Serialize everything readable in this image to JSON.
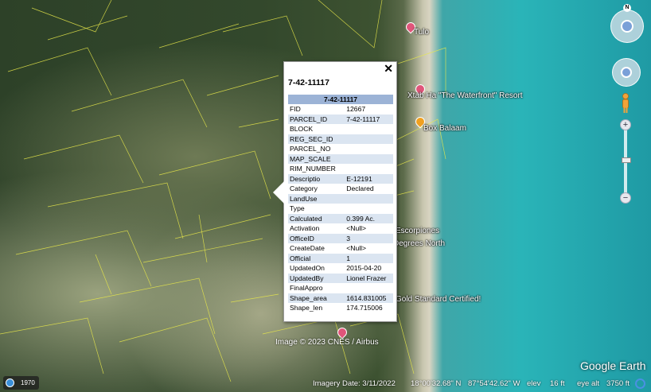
{
  "map": {
    "labels": [
      {
        "id": "tulo",
        "text": "Tulo"
      },
      {
        "id": "xtabha",
        "text": "Xtab Ha \"The Waterfront\" Resort"
      },
      {
        "id": "balaam",
        "text": "Box Balaam"
      },
      {
        "id": "escorpiones",
        "text": "Escorpiones"
      },
      {
        "id": "degrees-north",
        "text": "Degrees North"
      },
      {
        "id": "gold-standard",
        "text": "Gold Standard Certified!"
      }
    ],
    "pin_colors": {
      "pink": "#e0557a",
      "orange": "#f0a020"
    }
  },
  "popup": {
    "title": "7-42-11117",
    "table_header": "7-42-11117",
    "close_label": "✕",
    "rows": [
      {
        "field": "FID",
        "value": "12667"
      },
      {
        "field": "PARCEL_ID",
        "value": "7-42-11117"
      },
      {
        "field": "BLOCK",
        "value": ""
      },
      {
        "field": "REG_SEC_ID",
        "value": ""
      },
      {
        "field": "PARCEL_NO",
        "value": ""
      },
      {
        "field": "MAP_SCALE",
        "value": ""
      },
      {
        "field": "RIM_NUMBER",
        "value": ""
      },
      {
        "field": "Descriptio",
        "value": "E-12191"
      },
      {
        "field": "Category",
        "value": "Declared"
      },
      {
        "field": "LandUse",
        "value": ""
      },
      {
        "field": "Type",
        "value": ""
      },
      {
        "field": "Calculated",
        "value": "0.399 Ac."
      },
      {
        "field": "Activation",
        "value": "<Null>"
      },
      {
        "field": "OfficeID",
        "value": "3"
      },
      {
        "field": "CreateDate",
        "value": "<Null>"
      },
      {
        "field": "Official",
        "value": "1"
      },
      {
        "field": "UpdatedOn",
        "value": "2015-04-20"
      },
      {
        "field": "UpdatedBy",
        "value": "Lionel Frazer"
      },
      {
        "field": "FinalAppro",
        "value": ""
      },
      {
        "field": "Shape_area",
        "value": "1614.831005"
      },
      {
        "field": "Shape_len",
        "value": "174.715006"
      }
    ]
  },
  "nav": {
    "compass_label": "N",
    "zoom_in": "+",
    "zoom_out": "−"
  },
  "status": {
    "history_year": "1970",
    "imagery_credit": "Image © 2023 CNES / Airbus",
    "imagery_date": "Imagery Date: 3/11/2022",
    "lat": "18°00'32.68\" N",
    "lon": "87°54'42.62\" W",
    "elev_label": "elev",
    "elev_value": "16 ft",
    "eye_alt_label": "eye alt",
    "eye_alt_value": "3750 ft",
    "logo": "Google Earth"
  }
}
